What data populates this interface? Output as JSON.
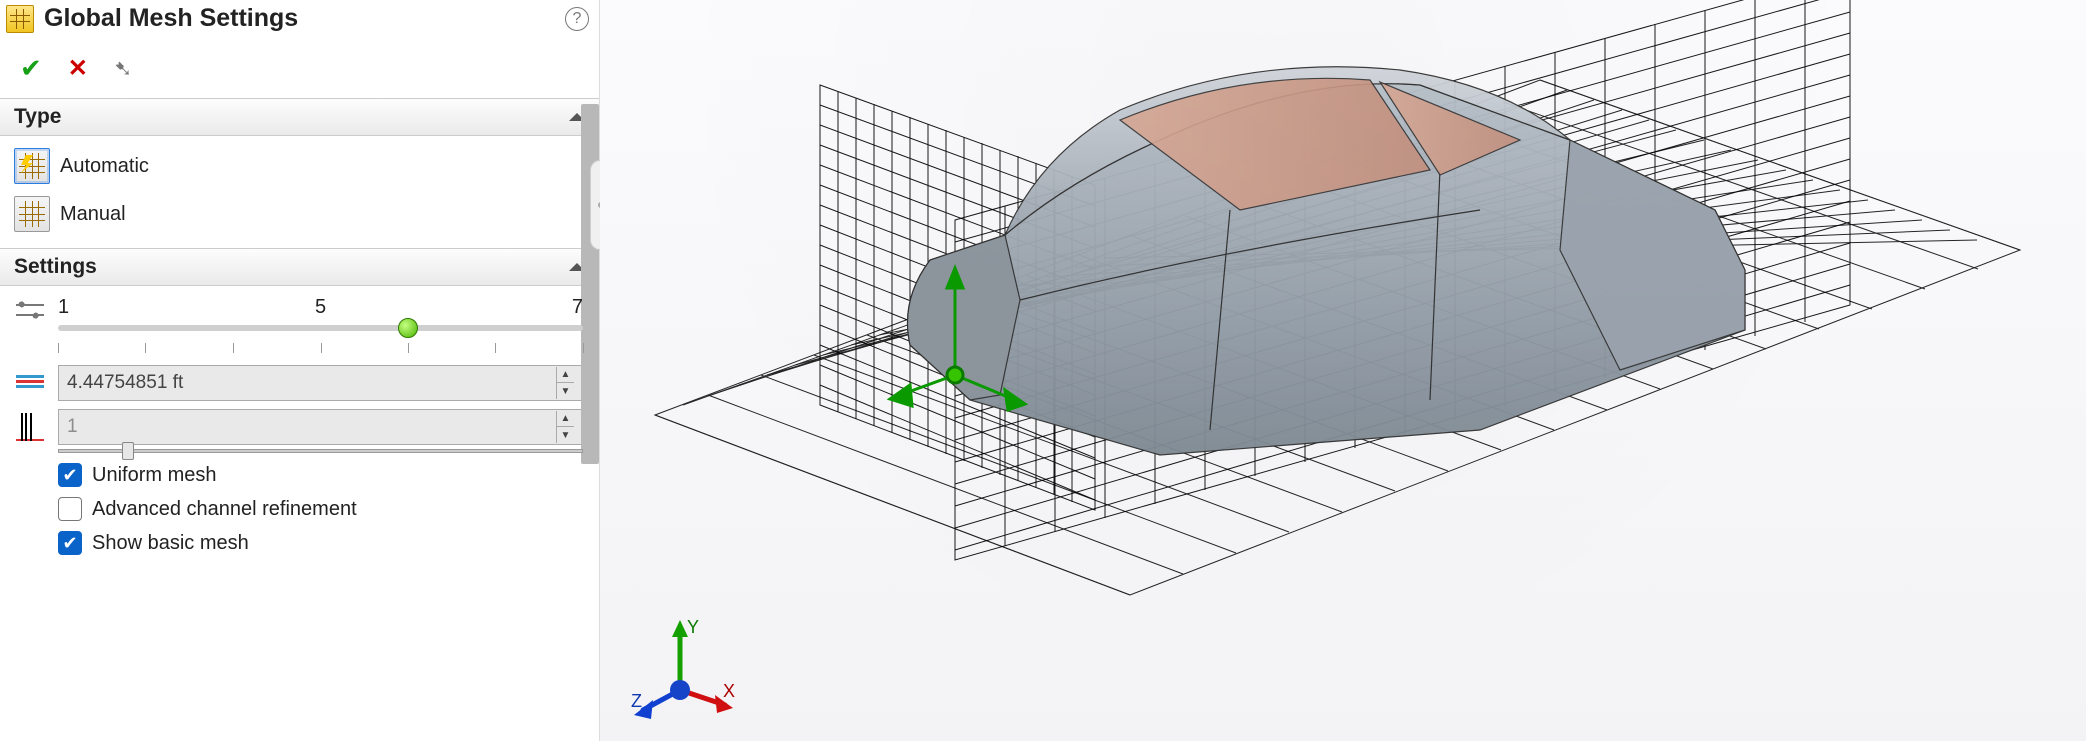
{
  "header": {
    "title": "Global Mesh Settings",
    "helpTooltip": "Help"
  },
  "commands": {
    "ok": "OK",
    "cancel": "Cancel",
    "pin": "Pin"
  },
  "sections": {
    "type": {
      "title": "Type"
    },
    "settings": {
      "title": "Settings"
    }
  },
  "type": {
    "automatic": "Automatic",
    "manual": "Manual",
    "selected": "automatic"
  },
  "settings": {
    "slider": {
      "min": "1",
      "mid": "5",
      "max": "7",
      "valuePercent": 66.7
    },
    "cellSize": "4.44754851 ft",
    "ratio": "1",
    "uniformMesh": {
      "label": "Uniform mesh",
      "checked": true
    },
    "advancedChannel": {
      "label": "Advanced channel refinement",
      "checked": false
    },
    "showBasicMesh": {
      "label": "Show basic mesh",
      "checked": true
    }
  },
  "triad": {
    "x": "X",
    "y": "Y",
    "z": "Z"
  }
}
